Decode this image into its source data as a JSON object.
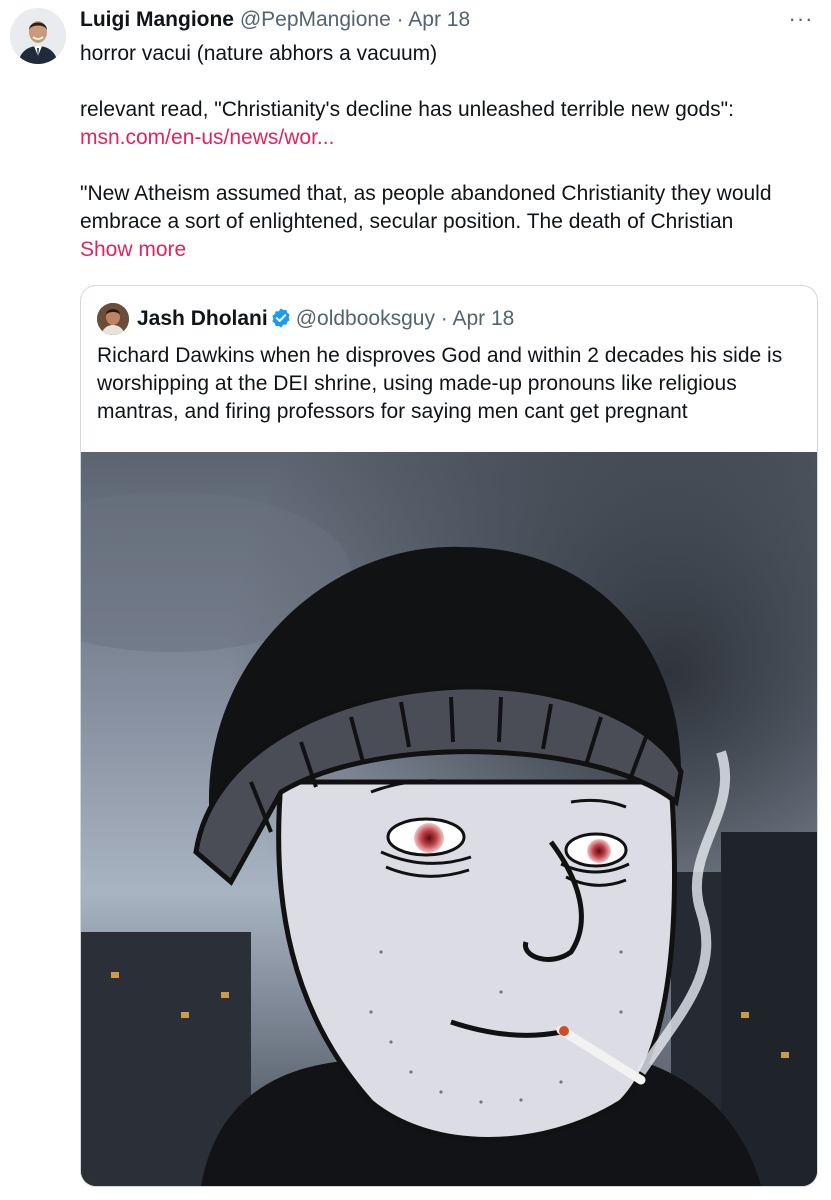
{
  "tweet": {
    "author_name": "Luigi Mangione",
    "handle": "@PepMangione",
    "separator": "·",
    "date": "Apr 18",
    "more_icon": "ellipsis-icon",
    "text_line1": "horror vacui (nature abhors a vacuum)",
    "text_line2": "relevant read, \"Christianity's decline has unleashed terrible new gods\":",
    "link": "msn.com/en-us/news/wor...",
    "text_line3": "\"New Atheism assumed that, as people abandoned Christianity they would embrace a sort of enlightened, secular position. The death of Christian",
    "show_more": "Show more"
  },
  "quoted_tweet": {
    "author_name": "Jash Dholani",
    "verified_icon": "verified-badge-icon",
    "handle": "@oldbooksguy",
    "separator": "·",
    "date": "Apr 18",
    "text": "Richard Dawkins when he disproves God and within 2 decades his side is worshipping at the DEI shrine, using made-up pronouns like religious mantras, and firing professors for saying men cant get pregnant"
  },
  "colors": {
    "link": "#e0245e",
    "muted": "#536471",
    "verified": "#1d9bf0",
    "border": "#cfd9de"
  }
}
